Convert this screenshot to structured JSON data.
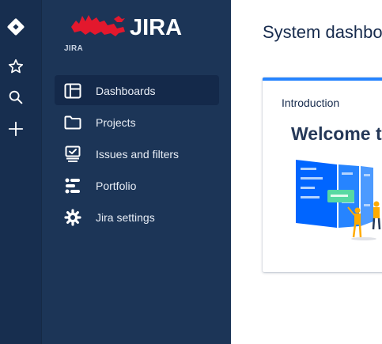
{
  "global_nav": {
    "items": [
      {
        "name": "jira-home",
        "icon": "jira-diamond-icon"
      },
      {
        "name": "starred",
        "icon": "star-icon"
      },
      {
        "name": "search",
        "icon": "search-icon"
      },
      {
        "name": "create",
        "icon": "plus-icon"
      }
    ]
  },
  "brand": {
    "logo_text": "JIRA",
    "sub_label": "JIRA",
    "logo_color": "#e3182d"
  },
  "sidebar": {
    "items": [
      {
        "label": "Dashboards",
        "icon": "dashboard-icon",
        "selected": true
      },
      {
        "label": "Projects",
        "icon": "folder-icon",
        "selected": false
      },
      {
        "label": "Issues and filters",
        "icon": "issues-icon",
        "selected": false
      },
      {
        "label": "Portfolio",
        "icon": "portfolio-icon",
        "selected": false
      },
      {
        "label": "Jira settings",
        "icon": "gear-icon",
        "selected": false
      }
    ]
  },
  "main": {
    "page_title": "System dashboard",
    "card": {
      "title": "Introduction",
      "welcome": "Welcome to Jira",
      "accent_color": "#2684ff"
    }
  },
  "colors": {
    "global_nav_bg": "#172e4f",
    "sidebar_bg": "#1c3557",
    "selected_bg": "#14294a",
    "text_light": "#e9eef6"
  }
}
